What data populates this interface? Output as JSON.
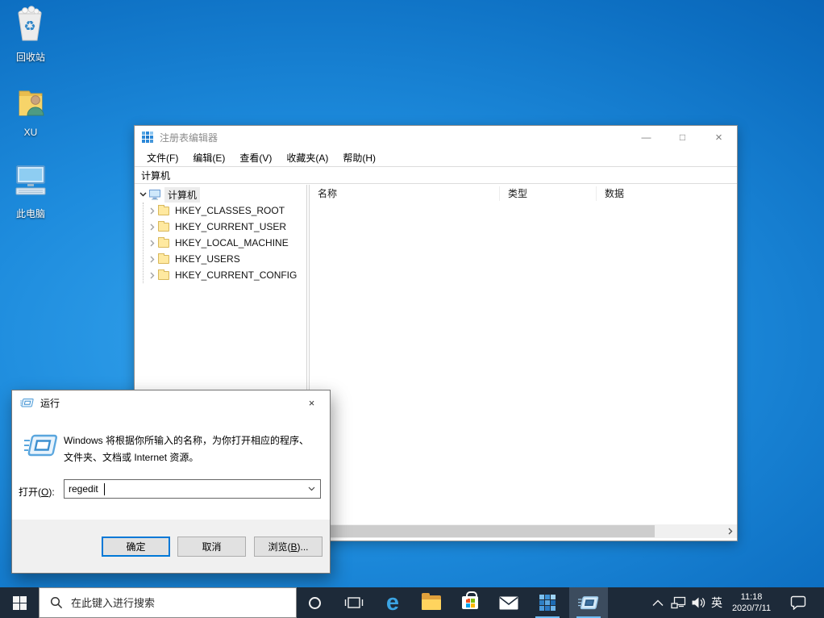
{
  "desktop": {
    "icons": [
      {
        "label": "回收站"
      },
      {
        "label": "XU"
      },
      {
        "label": "此电脑"
      }
    ]
  },
  "regedit": {
    "title": "注册表编辑器",
    "menus": [
      "文件(F)",
      "编辑(E)",
      "查看(V)",
      "收藏夹(A)",
      "帮助(H)"
    ],
    "address": "计算机",
    "tree": {
      "root": "计算机",
      "children": [
        "HKEY_CLASSES_ROOT",
        "HKEY_CURRENT_USER",
        "HKEY_LOCAL_MACHINE",
        "HKEY_USERS",
        "HKEY_CURRENT_CONFIG"
      ]
    },
    "columns": [
      "名称",
      "类型",
      "数据"
    ],
    "window_controls": {
      "minimize": "—",
      "maximize": "□",
      "close": "×"
    }
  },
  "run_dialog": {
    "title": "运行",
    "close": "×",
    "description_line1": "Windows 将根据你所输入的名称，为你打开相应的程序、",
    "description_line2": "文件夹、文档或 Internet 资源。",
    "open_label": {
      "pre": "打开(",
      "key": "O",
      "post": "):"
    },
    "input_value": "regedit",
    "buttons": {
      "ok": "确定",
      "cancel": "取消",
      "browse_pre": "浏览(",
      "browse_key": "B",
      "browse_post": ")..."
    }
  },
  "taskbar": {
    "search_placeholder": "在此键入进行搜索",
    "ime": "英",
    "time": "11:18",
    "date": "2020/7/11"
  },
  "colors": {
    "accent": "#0078d7",
    "taskbar_bg": "#1d2a39",
    "selection_unfocused": "#ececec",
    "desktop_center": "#37a6ef",
    "desktop_edge": "#0356a8",
    "store_squares": [
      "#f25022",
      "#7fba00",
      "#00a4ef",
      "#ffb900"
    ]
  }
}
